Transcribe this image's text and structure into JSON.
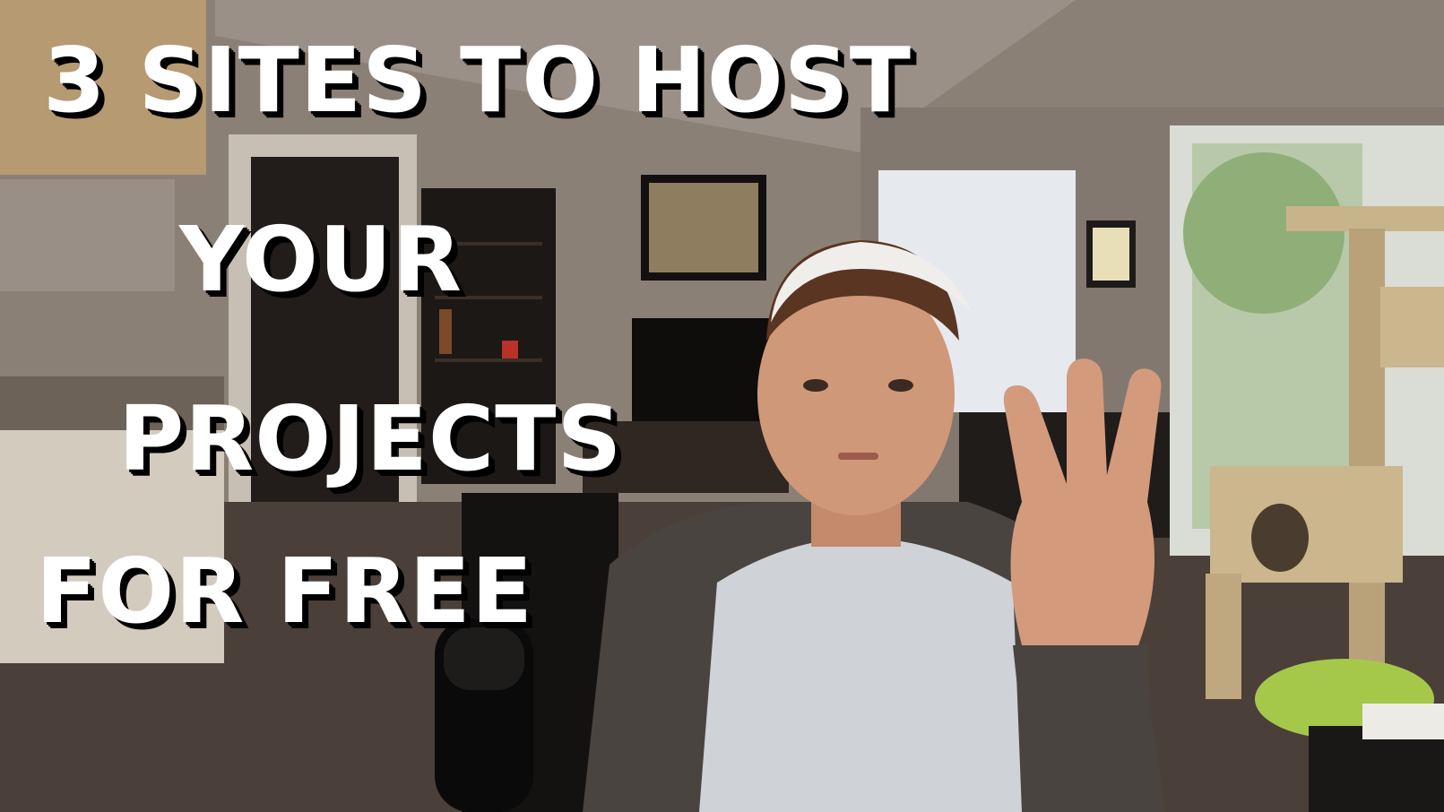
{
  "thumbnail": {
    "title_lines": [
      "3 SITES TO HOST",
      "YOUR",
      "PROJECTS",
      "FOR FREE"
    ],
    "text_color": "#ffffff",
    "shadow_color": "#000000"
  },
  "scene": {
    "description_icons": [
      "kitchen-cabinet",
      "doorway",
      "bookshelf",
      "framed-picture",
      "television",
      "window-blinds",
      "balcony-door",
      "cat-tree",
      "microphone",
      "person-holding-three-fingers"
    ]
  }
}
